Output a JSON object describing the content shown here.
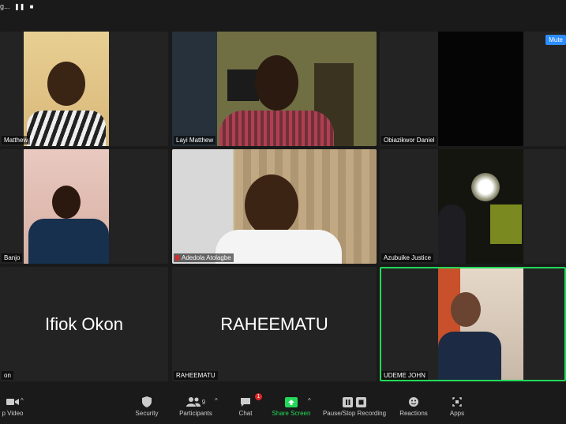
{
  "recording": {
    "label": "g...",
    "pause_icon": "pause-icon",
    "stop_icon": "stop-icon"
  },
  "mute_button": "Mute",
  "tiles": [
    {
      "name": "Matthew",
      "big": ""
    },
    {
      "name": "Layi Matthew",
      "big": ""
    },
    {
      "name": "Obiazikwor Daniel",
      "big": ""
    },
    {
      "name": "Banjo",
      "big": ""
    },
    {
      "name": "Adedola Atolagbe",
      "big": ""
    },
    {
      "name": "Azubuike Justice",
      "big": ""
    },
    {
      "name": "on",
      "big": "Ifiok Okon"
    },
    {
      "name": "RAHEEMATU",
      "big": "RAHEEMATU"
    },
    {
      "name": "UDEME JOHN",
      "big": ""
    }
  ],
  "toolbar": {
    "video": "p Video",
    "security": "Security",
    "participants": "Participants",
    "participants_count": "9",
    "chat": "Chat",
    "chat_badge": "1",
    "share": "Share Screen",
    "recording": "Pause/Stop Recording",
    "reactions": "Reactions",
    "apps": "Apps"
  },
  "colors": {
    "active_speaker": "#23d959",
    "share_green": "#23d959",
    "mute_blue": "#2d8cff",
    "badge_red": "#e02828"
  }
}
